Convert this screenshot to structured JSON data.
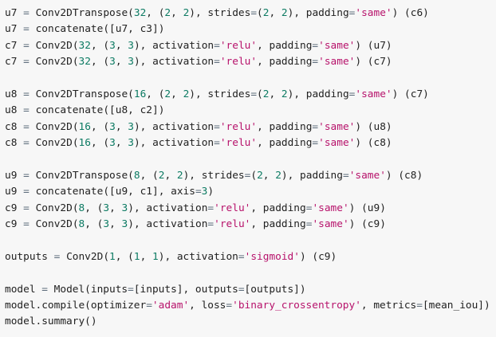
{
  "colors": {
    "background": "#f7f7f7",
    "text": "#212121",
    "string": "#b7126b",
    "number": "#0b7a62",
    "operator": "#5b6b7a"
  },
  "code": {
    "lines": [
      "u7 = Conv2DTranspose(32, (2, 2), strides=(2, 2), padding='same') (c6)",
      "u7 = concatenate([u7, c3])",
      "c7 = Conv2D(32, (3, 3), activation='relu', padding='same') (u7)",
      "c7 = Conv2D(32, (3, 3), activation='relu', padding='same') (c7)",
      "",
      "u8 = Conv2DTranspose(16, (2, 2), strides=(2, 2), padding='same') (c7)",
      "u8 = concatenate([u8, c2])",
      "c8 = Conv2D(16, (3, 3), activation='relu', padding='same') (u8)",
      "c8 = Conv2D(16, (3, 3), activation='relu', padding='same') (c8)",
      "",
      "u9 = Conv2DTranspose(8, (2, 2), strides=(2, 2), padding='same') (c8)",
      "u9 = concatenate([u9, c1], axis=3)",
      "c9 = Conv2D(8, (3, 3), activation='relu', padding='same') (u9)",
      "c9 = Conv2D(8, (3, 3), activation='relu', padding='same') (c9)",
      "",
      "outputs = Conv2D(1, (1, 1), activation='sigmoid') (c9)",
      "",
      "model = Model(inputs=[inputs], outputs=[outputs])",
      "model.compile(optimizer='adam', loss='binary_crossentropy', metrics=[mean_iou])",
      "model.summary()"
    ]
  }
}
